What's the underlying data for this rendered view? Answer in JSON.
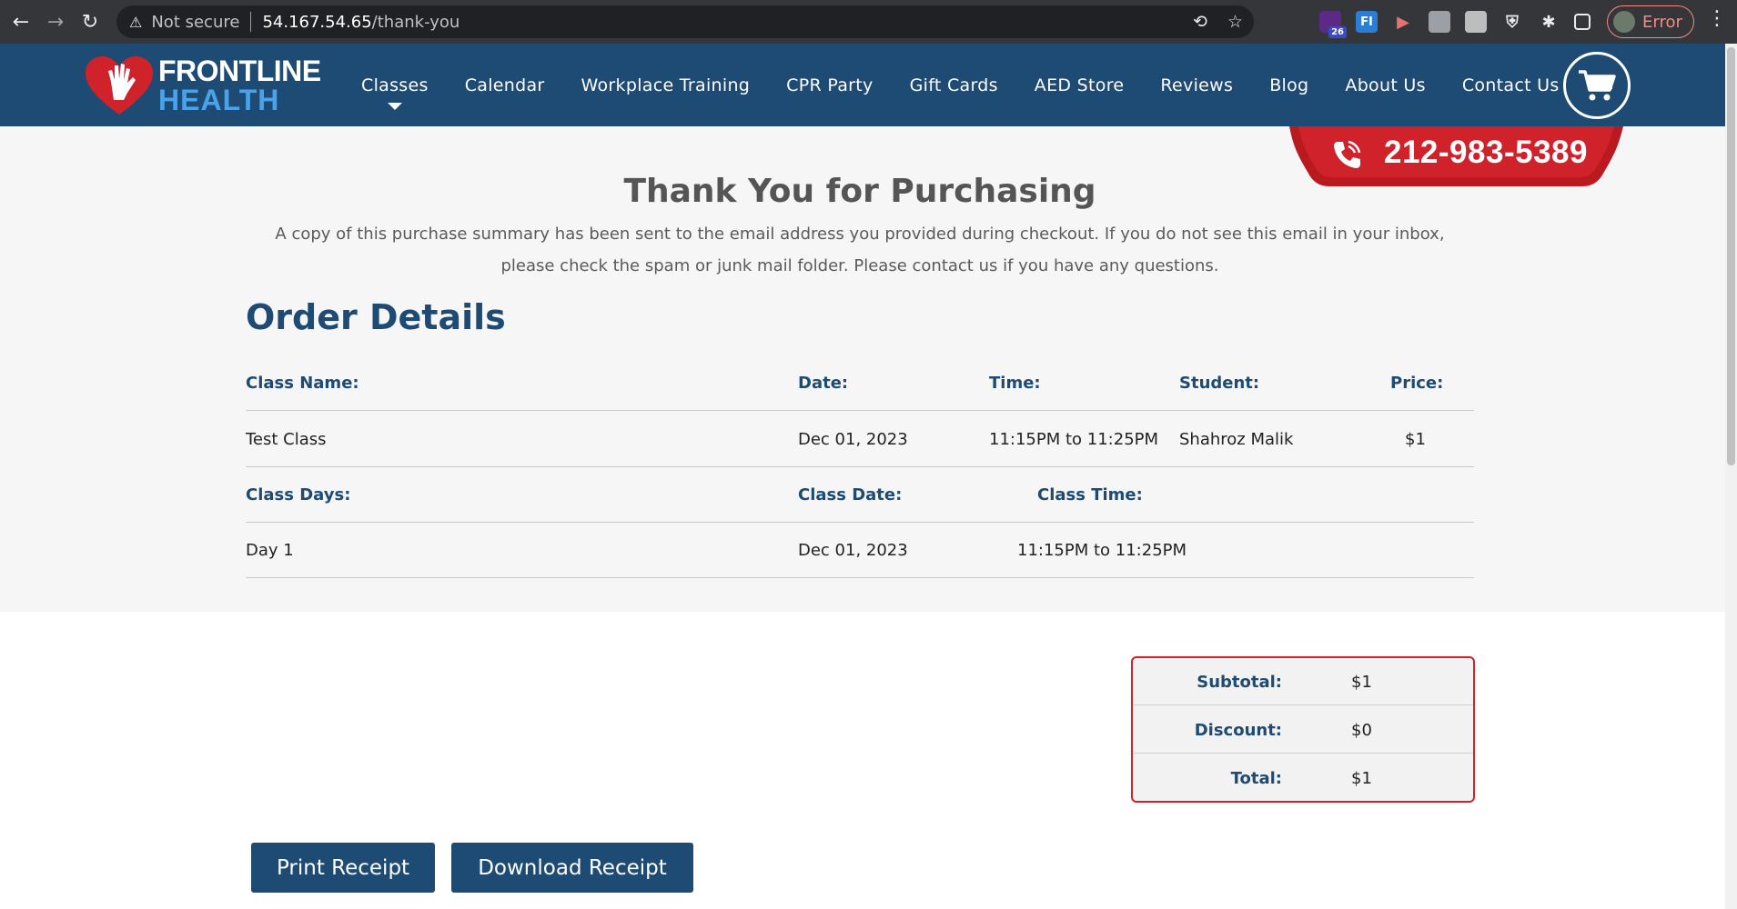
{
  "browser": {
    "back_icon": "arrow-left-icon",
    "forward_icon": "arrow-right-icon",
    "reload_icon": "reload-icon",
    "security_label": "Not secure",
    "url_host": "54.167.54.65",
    "url_path": "/thank-you",
    "extension_badge": "26",
    "extension_fi": "FI",
    "profile_status": "Error"
  },
  "site": {
    "logo_line1": "FRONTLINE",
    "logo_line2": "HEALTH",
    "nav": [
      {
        "label": "Classes"
      },
      {
        "label": "Calendar"
      },
      {
        "label": "Workplace Training"
      },
      {
        "label": "CPR Party"
      },
      {
        "label": "Gift Cards"
      },
      {
        "label": "AED Store"
      },
      {
        "label": "Reviews"
      },
      {
        "label": "Blog"
      },
      {
        "label": "About Us"
      },
      {
        "label": "Contact Us"
      }
    ],
    "phone": "212-983-5389",
    "colors": {
      "primary": "#1e4b74",
      "accent": "#d0222a",
      "logo_blue": "#4aa3ea"
    }
  },
  "page": {
    "heading": "Thank You for Purchasing",
    "notice": "A copy of this purchase summary has been sent to the email address you provided during checkout. If you do not see this email in your inbox, please check the spam or junk mail folder. Please contact us if you have any questions.",
    "order_title": "Order Details"
  },
  "order": {
    "headers": {
      "class_name": "Class Name:",
      "date": "Date:",
      "time": "Time:",
      "student": "Student:",
      "price": "Price:"
    },
    "item": {
      "class_name": "Test Class",
      "date": "Dec 01, 2023",
      "time": "11:15PM to 11:25PM",
      "student": "Shahroz Malik",
      "price": "$1"
    },
    "schedule_headers": {
      "class_days": "Class Days:",
      "class_date": "Class Date:",
      "class_time": "Class Time:"
    },
    "schedule": {
      "class_days": "Day 1",
      "class_date": "Dec 01, 2023",
      "class_time": "11:15PM to 11:25PM"
    }
  },
  "totals": {
    "subtotal_label": "Subtotal:",
    "subtotal": "$1",
    "discount_label": "Discount:",
    "discount": "$0",
    "total_label": "Total:",
    "total": "$1"
  },
  "actions": {
    "print_label": "Print Receipt",
    "download_label": "Download Receipt"
  }
}
